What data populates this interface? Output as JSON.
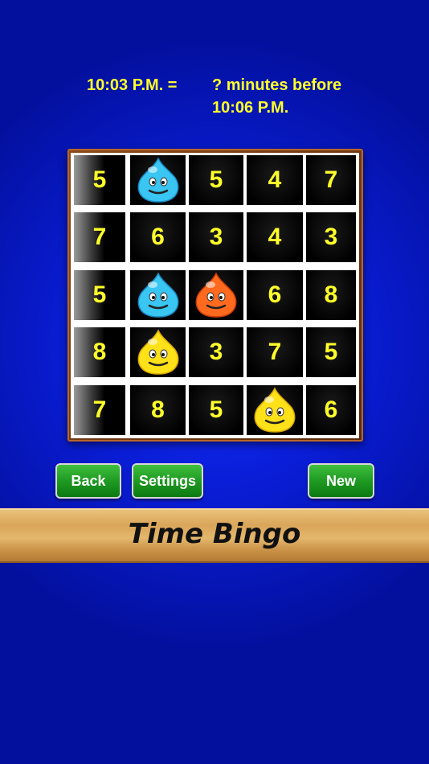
{
  "question": {
    "time_given": "10:03 P.M. =",
    "prompt_line1": "?  minutes before",
    "prompt_line2": "10:06 P.M."
  },
  "board": {
    "rows": [
      [
        "5",
        "drop:blue",
        "5",
        "4",
        "7"
      ],
      [
        "7",
        "6",
        "3",
        "4",
        "3"
      ],
      [
        "5",
        "drop:blue",
        "drop:orange",
        "6",
        "8"
      ],
      [
        "8",
        "drop:yellow",
        "3",
        "7",
        "5"
      ],
      [
        "7",
        "8",
        "5",
        "drop:yellow",
        "6"
      ]
    ]
  },
  "buttons": {
    "back": "Back",
    "settings": "Settings",
    "new": "New"
  },
  "title": "Time Bingo",
  "colors": {
    "number": "#ffff2a",
    "drop_blue": "#39c6f2",
    "drop_orange": "#ff6a1e",
    "drop_yellow": "#ffe11a",
    "button": "#1f9a22"
  }
}
